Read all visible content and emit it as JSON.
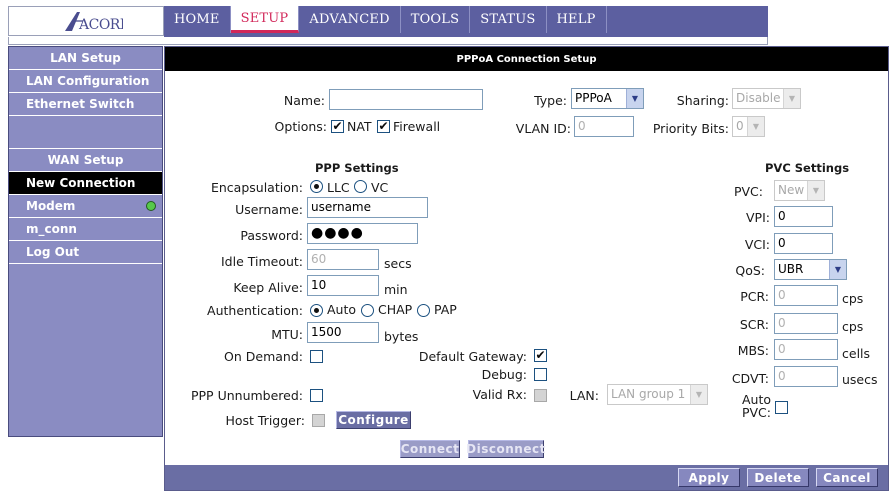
{
  "brand": {
    "logo_text": "ACORP"
  },
  "nav": {
    "tabs": [
      "HOME",
      "SETUP",
      "ADVANCED",
      "TOOLS",
      "STATUS",
      "HELP"
    ],
    "active": "SETUP"
  },
  "sidebar": {
    "lan_header": "LAN Setup",
    "lan_items": [
      "LAN Configuration",
      "Ethernet Switch"
    ],
    "wan_header": "WAN Setup",
    "wan_items": [
      "New Connection",
      "Modem",
      "m_conn",
      "Log Out"
    ],
    "active_item": "New Connection"
  },
  "page": {
    "title": "PPPoA Connection Setup"
  },
  "top": {
    "name_label": "Name:",
    "name_value": "",
    "type_label": "Type:",
    "type_value": "PPPoA",
    "sharing_label": "Sharing:",
    "sharing_value": "Disable",
    "options_label": "Options:",
    "nat_label": "NAT",
    "firewall_label": "Firewall",
    "nat_checked": true,
    "firewall_checked": true,
    "vlan_label": "VLAN ID:",
    "vlan_value": "0",
    "priority_label": "Priority Bits:",
    "priority_value": "0"
  },
  "ppp": {
    "title": "PPP Settings",
    "encapsulation_label": "Encapsulation:",
    "llc_label": "LLC",
    "vc_label": "VC",
    "encapsulation_selected": "LLC",
    "username_label": "Username:",
    "username_value": "username",
    "password_label": "Password:",
    "password_mask": "●●●●",
    "idle_label": "Idle Timeout:",
    "idle_value": "60",
    "idle_unit": "secs",
    "keepalive_label": "Keep Alive:",
    "keepalive_value": "10",
    "keepalive_unit": "min",
    "auth_label": "Authentication:",
    "auth_options": [
      "Auto",
      "CHAP",
      "PAP"
    ],
    "auth_selected": "Auto",
    "mtu_label": "MTU:",
    "mtu_value": "1500",
    "mtu_unit": "bytes",
    "ondemand_label": "On Demand:",
    "ondemand_checked": false,
    "gateway_label": "Default Gateway:",
    "gateway_checked": true,
    "debug_label": "Debug:",
    "debug_checked": false,
    "unnumbered_label": "PPP Unnumbered:",
    "unnumbered_checked": false,
    "validrx_label": "Valid Rx:",
    "lan_label": "LAN:",
    "lan_value": "LAN group 1",
    "host_trigger_label": "Host Trigger:",
    "configure_label": "Configure",
    "connect_label": "Connect",
    "disconnect_label": "Disconnect"
  },
  "pvc": {
    "title": "PVC Settings",
    "pvc_label": "PVC:",
    "pvc_value": "New",
    "vpi_label": "VPI:",
    "vpi_value": "0",
    "vci_label": "VCI:",
    "vci_value": "0",
    "qos_label": "QoS:",
    "qos_value": "UBR",
    "pcr_label": "PCR:",
    "pcr_value": "0",
    "pcr_unit": "cps",
    "scr_label": "SCR:",
    "scr_value": "0",
    "scr_unit": "cps",
    "mbs_label": "MBS:",
    "mbs_value": "0",
    "mbs_unit": "cells",
    "cdvt_label": "CDVT:",
    "cdvt_value": "0",
    "cdvt_unit": "usecs",
    "autopvc_label_1": "Auto",
    "autopvc_label_2": "PVC:",
    "autopvc_checked": false
  },
  "actions": {
    "apply": "Apply",
    "delete": "Delete",
    "cancel": "Cancel"
  },
  "colors": {
    "nav_bg": "#5c5fa0",
    "sidebar_bg": "#8a8cc2",
    "active_tab_text": "#d2285a",
    "modem_status": "#57c94a"
  }
}
